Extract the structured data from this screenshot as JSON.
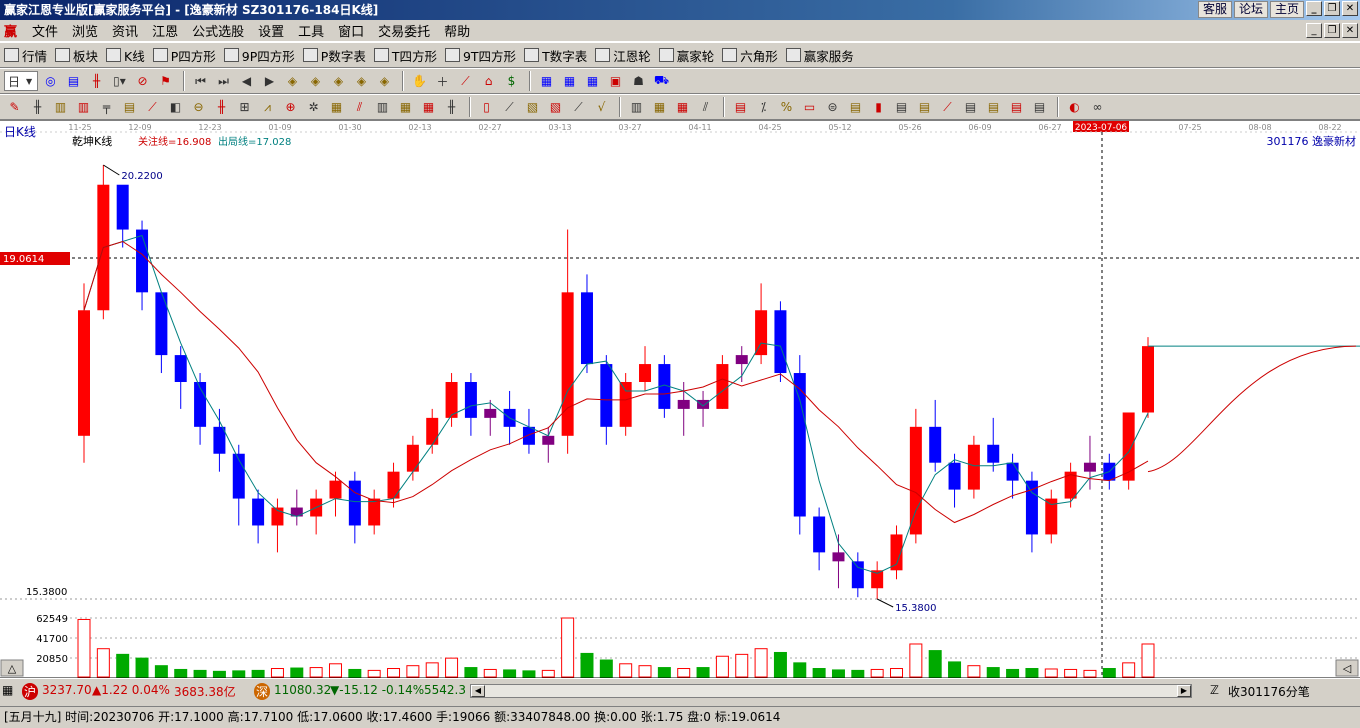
{
  "app": {
    "title": "赢家江恩专业版[赢家服务平台] - [逸豪新材   SZ301176-184日K线]",
    "title_links": [
      "客服",
      "论坛",
      "主页"
    ]
  },
  "menu": {
    "logo": "赢",
    "items": [
      "文件",
      "浏览",
      "资讯",
      "江恩",
      "公式选股",
      "设置",
      "工具",
      "窗口",
      "交易委托",
      "帮助"
    ]
  },
  "toolbar1": {
    "items": [
      {
        "label": "行情",
        "icon": "grid-icon"
      },
      {
        "label": "板块",
        "icon": "blocks-icon"
      },
      {
        "label": "K线",
        "icon": "kline-icon"
      },
      {
        "label": "P四方形",
        "icon": "p-square-icon"
      },
      {
        "label": "9P四方形",
        "icon": "9p-square-icon"
      },
      {
        "label": "P数字表",
        "icon": "pn-table-icon"
      },
      {
        "label": "T四方形",
        "icon": "t-square-icon"
      },
      {
        "label": "9T四方形",
        "icon": "9t-square-icon"
      },
      {
        "label": "T数字表",
        "icon": "tn-table-icon"
      },
      {
        "label": "江恩轮",
        "icon": "gann-wheel-icon"
      },
      {
        "label": "赢家轮",
        "icon": "winner-wheel-icon"
      },
      {
        "label": "六角形",
        "icon": "hexagon-icon"
      },
      {
        "label": "赢家服务",
        "icon": "service-icon"
      }
    ]
  },
  "toolbar2": {
    "period": "日"
  },
  "chart": {
    "period_label": "日K线",
    "indicator_name": "乾坤K线",
    "focus_line_label": "关注线=16.908",
    "exit_line_label": "出局线=17.028",
    "stock_label": "301176  逸豪新材",
    "date_ticks": [
      "11-25",
      "12-09",
      "12-23",
      "01-09",
      "01-30",
      "02-13",
      "02-27",
      "03-13",
      "03-27",
      "04-11",
      "04-25",
      "05-12",
      "05-26",
      "06-09",
      "06-27",
      "2023-07-06",
      "07-25",
      "08-08",
      "08-22"
    ],
    "high_label": "20.2200",
    "low_label": "15.3800",
    "low_axis_label": "15.3800",
    "cursor_price": "19.0614",
    "volume_ticks": [
      "62549",
      "41700",
      "20850"
    ],
    "colors": {
      "up": "#ff0000",
      "down": "#0000ff",
      "neutral": "#800080",
      "focus": "#cc0000",
      "exit": "#008080",
      "vol_up": "#ff0000",
      "vol_down": "#00aa00"
    }
  },
  "chart_data": {
    "type": "candlestick",
    "price_range": [
      15.38,
      20.22
    ],
    "bars_approx": [
      [
        17.2,
        18.9,
        16.9,
        18.6
      ],
      [
        18.6,
        20.22,
        18.5,
        20.0
      ],
      [
        20.0,
        19.9,
        19.3,
        19.5
      ],
      [
        19.5,
        19.6,
        18.6,
        18.8
      ],
      [
        18.8,
        18.8,
        17.9,
        18.1
      ],
      [
        18.1,
        18.2,
        17.5,
        17.8
      ],
      [
        17.8,
        17.9,
        17.1,
        17.3
      ],
      [
        17.3,
        17.5,
        16.8,
        17.0
      ],
      [
        17.0,
        17.1,
        16.2,
        16.5
      ],
      [
        16.5,
        16.6,
        16.0,
        16.2
      ],
      [
        16.2,
        16.5,
        15.9,
        16.4
      ],
      [
        16.4,
        16.6,
        16.2,
        16.3
      ],
      [
        16.3,
        16.6,
        16.1,
        16.5
      ],
      [
        16.5,
        16.8,
        16.3,
        16.7
      ],
      [
        16.7,
        16.8,
        16.0,
        16.2
      ],
      [
        16.2,
        16.6,
        16.1,
        16.5
      ],
      [
        16.5,
        16.9,
        16.4,
        16.8
      ],
      [
        16.8,
        17.2,
        16.7,
        17.1
      ],
      [
        17.1,
        17.5,
        17.0,
        17.4
      ],
      [
        17.4,
        17.9,
        17.3,
        17.8
      ],
      [
        17.8,
        17.9,
        17.2,
        17.4
      ],
      [
        17.4,
        17.6,
        17.2,
        17.5
      ],
      [
        17.5,
        17.7,
        17.1,
        17.3
      ],
      [
        17.3,
        17.5,
        17.0,
        17.1
      ],
      [
        17.1,
        17.3,
        16.9,
        17.2
      ],
      [
        17.2,
        19.5,
        17.0,
        18.8
      ],
      [
        18.8,
        19.0,
        17.9,
        18.0
      ],
      [
        18.0,
        18.1,
        17.1,
        17.3
      ],
      [
        17.3,
        17.9,
        17.2,
        17.8
      ],
      [
        17.8,
        18.2,
        17.7,
        18.0
      ],
      [
        18.0,
        18.1,
        17.4,
        17.5
      ],
      [
        17.5,
        17.8,
        17.2,
        17.6
      ],
      [
        17.6,
        17.7,
        17.3,
        17.5
      ],
      [
        17.5,
        18.1,
        17.5,
        18.0
      ],
      [
        18.0,
        18.2,
        17.8,
        18.1
      ],
      [
        18.1,
        18.9,
        18.0,
        18.6
      ],
      [
        18.6,
        18.7,
        17.8,
        17.9
      ],
      [
        17.9,
        18.1,
        16.1,
        16.3
      ],
      [
        16.3,
        16.4,
        15.7,
        15.9
      ],
      [
        15.9,
        16.1,
        15.5,
        15.8
      ],
      [
        15.8,
        15.9,
        15.4,
        15.5
      ],
      [
        15.5,
        15.8,
        15.38,
        15.7
      ],
      [
        15.7,
        16.2,
        15.6,
        16.1
      ],
      [
        16.1,
        17.5,
        16.0,
        17.3
      ],
      [
        17.3,
        17.6,
        16.8,
        16.9
      ],
      [
        16.9,
        17.0,
        16.4,
        16.6
      ],
      [
        16.6,
        17.2,
        16.5,
        17.1
      ],
      [
        17.1,
        17.4,
        16.8,
        16.9
      ],
      [
        16.9,
        17.0,
        16.5,
        16.7
      ],
      [
        16.7,
        16.8,
        15.9,
        16.1
      ],
      [
        16.1,
        16.6,
        16.0,
        16.5
      ],
      [
        16.5,
        16.9,
        16.4,
        16.8
      ],
      [
        16.8,
        17.2,
        16.6,
        16.9
      ],
      [
        16.9,
        17.0,
        16.6,
        16.7
      ],
      [
        16.7,
        17.46,
        16.6,
        17.46
      ],
      [
        17.46,
        18.3,
        17.4,
        18.2
      ]
    ],
    "volumes_approx": [
      61000,
      30000,
      24000,
      20000,
      12000,
      8000,
      7000,
      6000,
      6500,
      7000,
      9000,
      9500,
      10000,
      14000,
      8000,
      7000,
      9000,
      12000,
      15000,
      20000,
      10000,
      8000,
      7500,
      6500,
      7000,
      62549,
      25000,
      18000,
      14000,
      12000,
      10000,
      9000,
      10000,
      22000,
      24000,
      30000,
      26000,
      15000,
      9000,
      7500,
      7000,
      8000,
      9000,
      35000,
      28000,
      16000,
      12000,
      10000,
      8000,
      9000,
      8500,
      8000,
      7000,
      9000,
      15000,
      35000
    ]
  },
  "status": {
    "sh_badge": "沪",
    "sh_value": "3237.70",
    "sh_change": "▲1.22 0.04%",
    "sh_amount": "3683.38亿",
    "sz_badge": "深",
    "sz_value": "11080.32",
    "sz_change": "▼-15.12 -0.14%",
    "sz_amount": "5542.3",
    "tick_label": "收301176分笔"
  },
  "info": {
    "text": "[五月十九] 时间:20230706 开:17.1000 高:17.7100 低:17.0600 收:17.4600 手:19066 额:33407848.00 换:0.00 张:1.75 盘:0 标:19.0614"
  }
}
